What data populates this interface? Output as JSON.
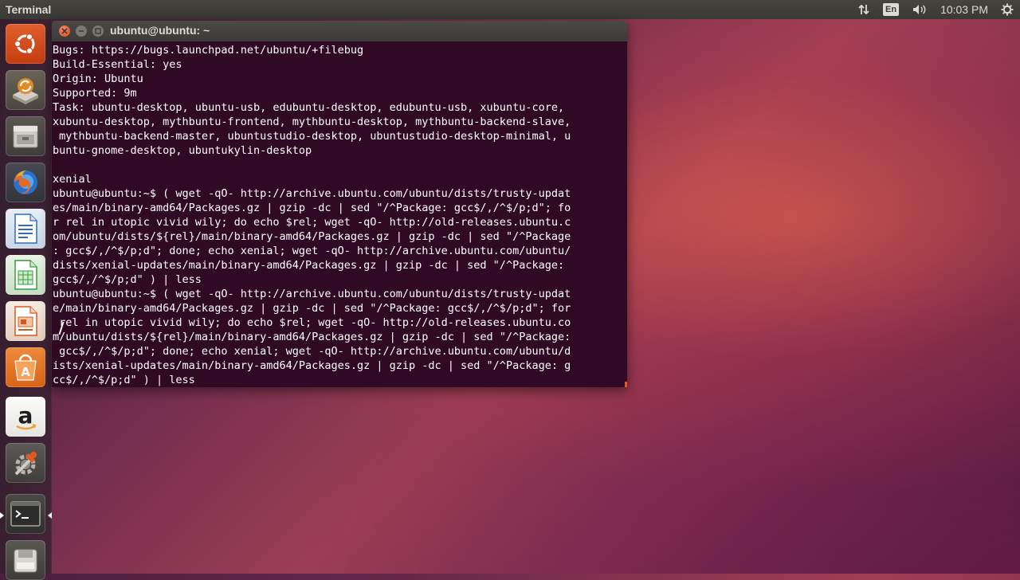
{
  "top_panel": {
    "app_title": "Terminal",
    "keyboard_layout": "En",
    "clock": "10:03 PM",
    "icons": [
      "network-arrows-icon",
      "keyboard-layout-icon",
      "volume-icon",
      "system-gear-icon"
    ]
  },
  "launcher": {
    "items": [
      {
        "name": "ubuntu-dash-icon",
        "color": "#dd4814"
      },
      {
        "name": "software-updater-icon",
        "color": "#d9711f"
      },
      {
        "name": "files-icon",
        "color": "#8f8f8a"
      },
      {
        "name": "firefox-icon",
        "color": "#e6651f"
      },
      {
        "name": "libreoffice-writer-icon",
        "color": "#2f6fb3"
      },
      {
        "name": "libreoffice-calc-icon",
        "color": "#3b9a3e"
      },
      {
        "name": "libreoffice-impress-icon",
        "color": "#d65a1f"
      },
      {
        "name": "ubuntu-software-center-icon",
        "color": "#e07526"
      },
      {
        "name": "amazon-icon",
        "color": "#f0efec"
      },
      {
        "name": "system-settings-icon",
        "color": "#c94b1e"
      },
      {
        "name": "terminal-icon",
        "color": "#2c2c2c"
      },
      {
        "name": "disk-icon",
        "color": "#8a8a86"
      }
    ]
  },
  "window": {
    "title": "ubuntu@ubuntu: ~",
    "accent": "#e95420",
    "background": "#300a24"
  },
  "terminal": {
    "lines": [
      "Bugs: https://bugs.launchpad.net/ubuntu/+filebug",
      "Build-Essential: yes",
      "Origin: Ubuntu",
      "Supported: 9m",
      "Task: ubuntu-desktop, ubuntu-usb, edubuntu-desktop, edubuntu-usb, xubuntu-core,",
      "xubuntu-desktop, mythbuntu-frontend, mythbuntu-desktop, mythbuntu-backend-slave,",
      " mythbuntu-backend-master, ubuntustudio-desktop, ubuntustudio-desktop-minimal, u",
      "buntu-gnome-desktop, ubuntukylin-desktop",
      "",
      "xenial",
      "ubuntu@ubuntu:~$ ( wget -qO- http://archive.ubuntu.com/ubuntu/dists/trusty-updat",
      "es/main/binary-amd64/Packages.gz | gzip -dc | sed \"/^Package: gcc$/,/^$/p;d\"; fo",
      "r rel in utopic vivid wily; do echo $rel; wget -qO- http://old-releases.ubuntu.c",
      "om/ubuntu/dists/${rel}/main/binary-amd64/Packages.gz | gzip -dc | sed \"/^Package",
      ": gcc$/,/^$/p;d\"; done; echo xenial; wget -qO- http://archive.ubuntu.com/ubuntu/",
      "dists/xenial-updates/main/binary-amd64/Packages.gz | gzip -dc | sed \"/^Package:",
      "gcc$/,/^$/p;d\" ) | less",
      "ubuntu@ubuntu:~$ ( wget -qO- http://archive.ubuntu.com/ubuntu/dists/trusty-updat",
      "e/main/binary-amd64/Packages.gz | gzip -dc | sed \"/^Package: gcc$/,/^$/p;d\"; for",
      " rel in utopic vivid wily; do echo $rel; wget -qO- http://old-releases.ubuntu.co",
      "m/ubuntu/dists/${rel}/main/binary-amd64/Packages.gz | gzip -dc | sed \"/^Package:",
      " gcc$/,/^$/p;d\"; done; echo xenial; wget -qO- http://archive.ubuntu.com/ubuntu/d",
      "ists/xenial-updates/main/binary-amd64/Packages.gz | gzip -dc | sed \"/^Package: g",
      "cc$/,/^$/p;d\" ) | less"
    ]
  }
}
